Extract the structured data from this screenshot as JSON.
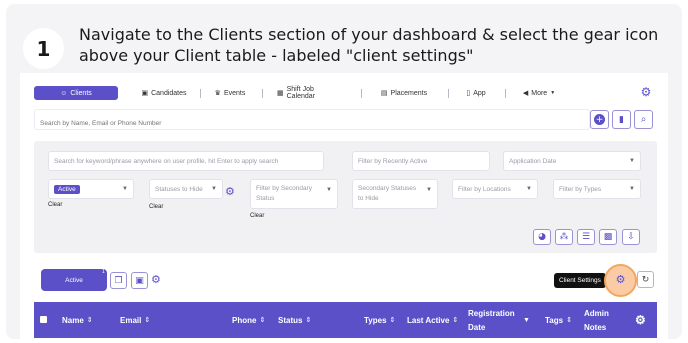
{
  "instruction": {
    "step_number": "1",
    "text": "Navigate to the Clients section of your dashboard & select the gear icon above your Client table - labeled \"client settings\""
  },
  "tabs": [
    {
      "label": "Clients",
      "icon": "user-circle-icon",
      "active": true
    },
    {
      "label": "Candidates",
      "icon": "briefcase-icon",
      "active": false
    },
    {
      "label": "Events",
      "icon": "trophy-icon",
      "active": false
    },
    {
      "label": "Shift Job Calendar",
      "icon": "calendar-icon",
      "active": false
    },
    {
      "label": "Placements",
      "icon": "suitcase-icon",
      "active": false
    },
    {
      "label": "App",
      "icon": "phone-icon",
      "active": false
    },
    {
      "label": "More",
      "icon": "megaphone-icon",
      "active": false
    }
  ],
  "search": {
    "placeholder": "Search by Name, Email or Phone Number"
  },
  "filters": {
    "keyword_placeholder": "Search for keyword/phrase anywhere on user profile, hit Enter to apply search",
    "recently_active_placeholder": "Filter by Recently Active",
    "application_date_placeholder": "Application Date",
    "status_value": "Active",
    "statuses_to_hide_placeholder": "Statuses to Hide",
    "secondary_status_placeholder": "Filter by Secondary Status",
    "secondary_statuses_hide_placeholder": "Secondary Statuses to Hide",
    "locations_placeholder": "Filter by Locations",
    "types_placeholder": "Filter by Types",
    "clear_label": "Clear"
  },
  "toolbar": {
    "active_label": "Active",
    "active_badge": "1"
  },
  "tooltip": {
    "text": "Client Settings"
  },
  "table": {
    "columns": [
      {
        "label": "Name"
      },
      {
        "label": "Email"
      },
      {
        "label": "Phone"
      },
      {
        "label": "Status"
      },
      {
        "label": "Types"
      },
      {
        "label": "Last Active"
      },
      {
        "label_line1": "Registration",
        "label_line2": "Date"
      },
      {
        "label": "Tags"
      },
      {
        "label_line1": "Admin",
        "label_line2": "Notes"
      }
    ]
  },
  "colors": {
    "accent": "#5b50c8",
    "highlight": "#f2a75c"
  }
}
